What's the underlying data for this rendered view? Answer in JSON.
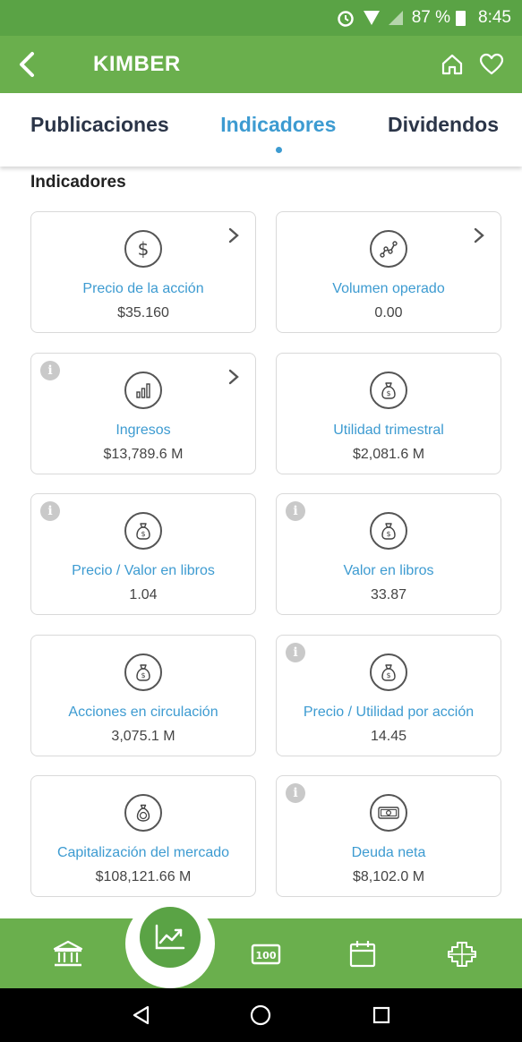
{
  "status_bar": {
    "battery": "87 %",
    "time": "8:45"
  },
  "app_bar": {
    "title": "KIMBER"
  },
  "tabs": [
    {
      "label": "Publicaciones",
      "active": false
    },
    {
      "label": "Indicadores",
      "active": true
    },
    {
      "label": "Dividendos",
      "active": false
    }
  ],
  "section": {
    "title": "Indicadores"
  },
  "cards": [
    {
      "label": "Precio de la acción",
      "value": "$35.160",
      "icon": "dollar-icon",
      "info": false,
      "chevron": true
    },
    {
      "label": "Volumen operado",
      "value": "0.00",
      "icon": "line-chart-icon",
      "info": false,
      "chevron": true
    },
    {
      "label": "Ingresos",
      "value": "$13,789.6 M",
      "icon": "bar-chart-icon",
      "info": true,
      "chevron": true
    },
    {
      "label": "Utilidad trimestral",
      "value": "$2,081.6 M",
      "icon": "money-bag-icon",
      "info": false,
      "chevron": false
    },
    {
      "label": "Precio / Valor en libros",
      "value": "1.04",
      "icon": "money-bag-icon",
      "info": true,
      "chevron": false
    },
    {
      "label": "Valor en libros",
      "value": "33.87",
      "icon": "money-bag-icon",
      "info": true,
      "chevron": false
    },
    {
      "label": "Acciones en circulación",
      "value": "3,075.1 M",
      "icon": "money-bag-icon",
      "info": false,
      "chevron": false
    },
    {
      "label": "Precio / Utilidad por acción",
      "value": "14.45",
      "icon": "money-bag-icon",
      "info": true,
      "chevron": false
    },
    {
      "label": "Capitalización del mercado",
      "value": "$108,121.66 M",
      "icon": "coin-bag-icon",
      "info": false,
      "chevron": false
    },
    {
      "label": "Deuda neta",
      "value": "$8,102.0 M",
      "icon": "banknote-icon",
      "info": true,
      "chevron": false
    }
  ],
  "info_glyph": "i",
  "bottom_nav": [
    {
      "icon": "bank-icon",
      "active": false
    },
    {
      "icon": "trend-chart-icon",
      "active": true
    },
    {
      "icon": "ticker-icon",
      "active": false
    },
    {
      "icon": "calendar-icon",
      "active": false
    },
    {
      "icon": "globe-puzzle-icon",
      "active": false
    }
  ],
  "colors": {
    "primary_green": "#6aaf4d",
    "accent_blue": "#3d9bd1",
    "tab_dark": "#2b3548"
  }
}
